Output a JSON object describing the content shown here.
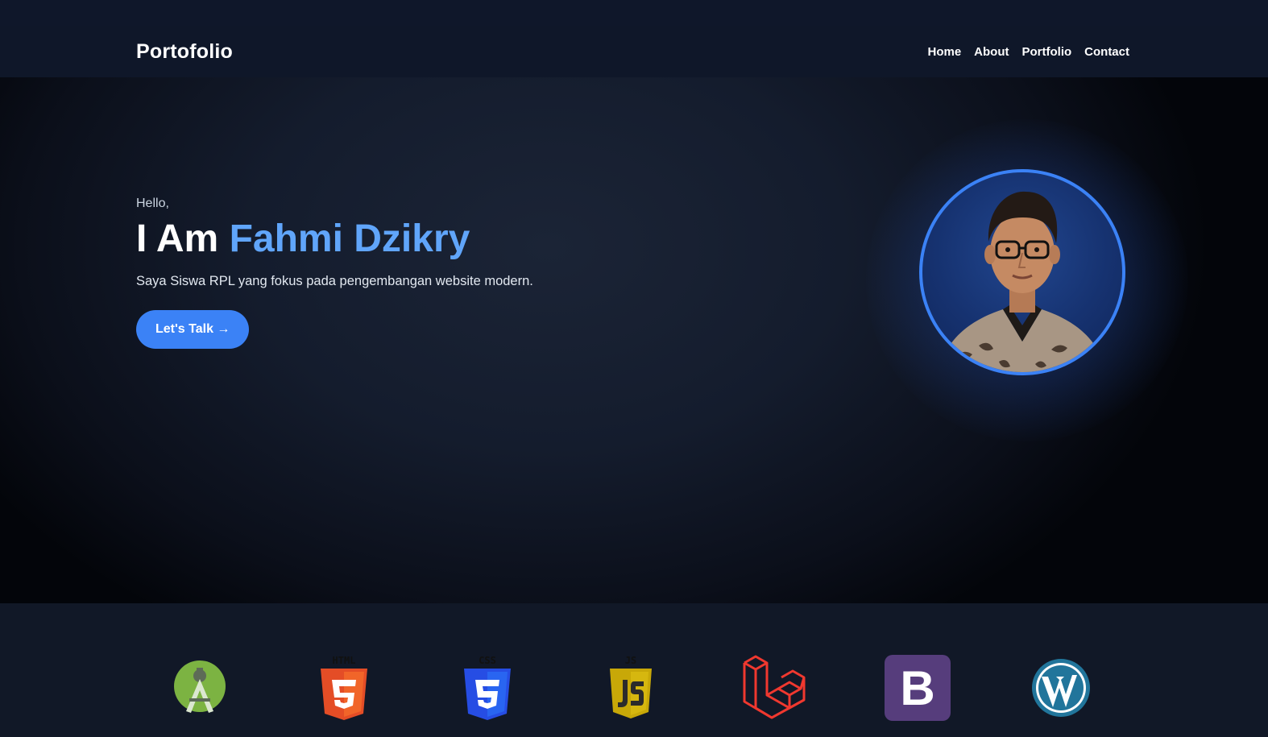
{
  "navbar": {
    "brand": "Portofolio",
    "links": [
      "Home",
      "About",
      "Portfolio",
      "Contact"
    ]
  },
  "hero": {
    "greeting": "Hello,",
    "headline_prefix": "I Am",
    "name": "Fahmi Dzikry",
    "tagline": "Saya Siswa RPL yang fokus pada pengembangan website modern.",
    "cta_label": "Let's Talk →",
    "avatar_icon": "profile-photo"
  },
  "tech_stack": {
    "icons": [
      "android-studio-icon",
      "html5-icon",
      "css3-icon",
      "javascript-icon",
      "laravel-icon",
      "bootstrap-icon",
      "wordpress-icon"
    ],
    "html5_badge": "HTML",
    "css3_badge": "CSS",
    "js_badge": "JS",
    "bootstrap_letter": "B"
  },
  "colors": {
    "accent": "#3b82f6",
    "name_accent": "#60a5fa",
    "navbar_bg": "#0f1729",
    "techbar_bg": "#111827"
  }
}
